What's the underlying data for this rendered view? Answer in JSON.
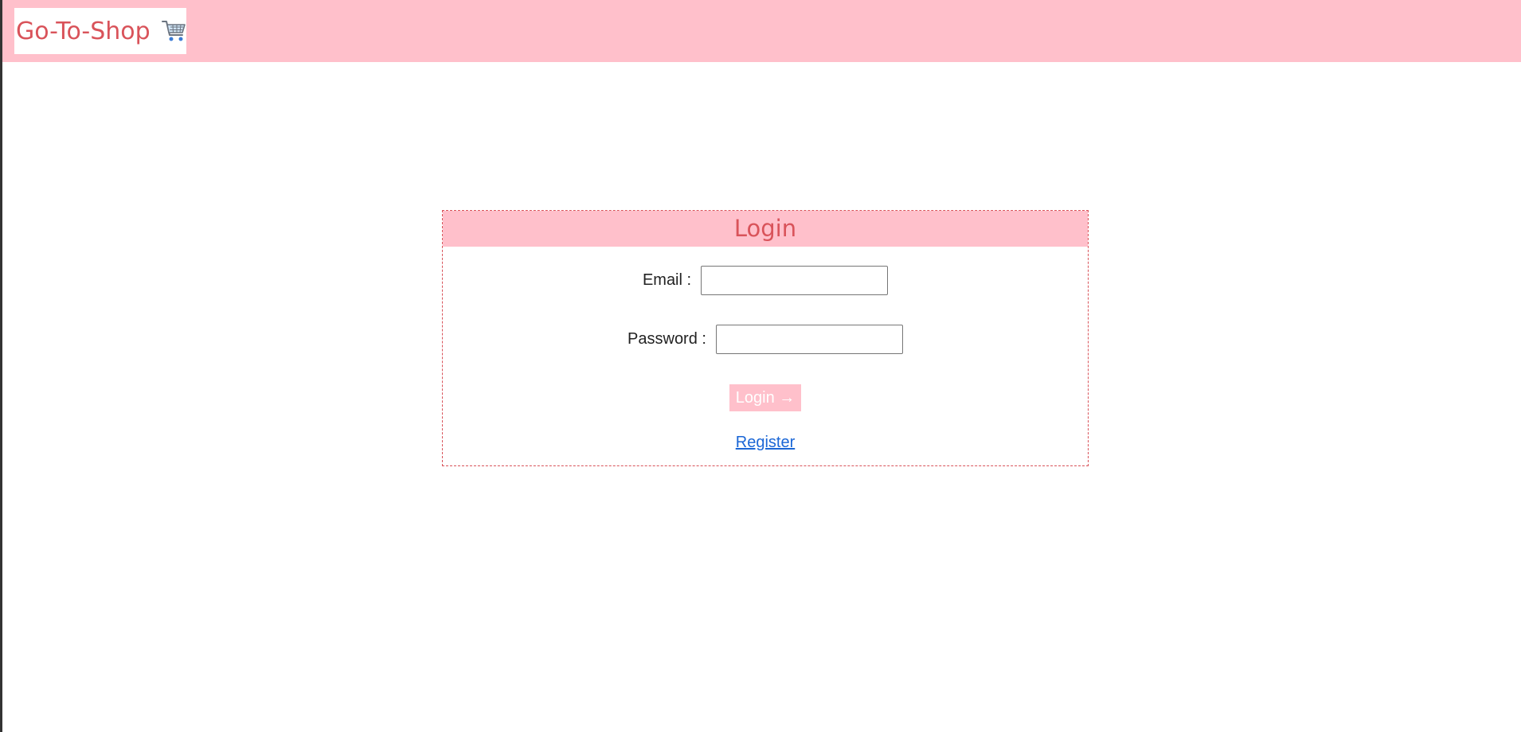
{
  "header": {
    "brand": "Go-To-Shop",
    "brand_icon": "shopping-cart-icon",
    "background": "#ffc0cb",
    "brand_color": "#d9535a"
  },
  "login": {
    "title": "Login",
    "email_label": "Email :",
    "email_value": "",
    "password_label": "Password :",
    "password_value": "",
    "submit_label": "Login →",
    "register_label": "Register"
  },
  "colors": {
    "accent": "#ffc0cb",
    "title": "#d9535a",
    "link": "#1a66d6"
  }
}
